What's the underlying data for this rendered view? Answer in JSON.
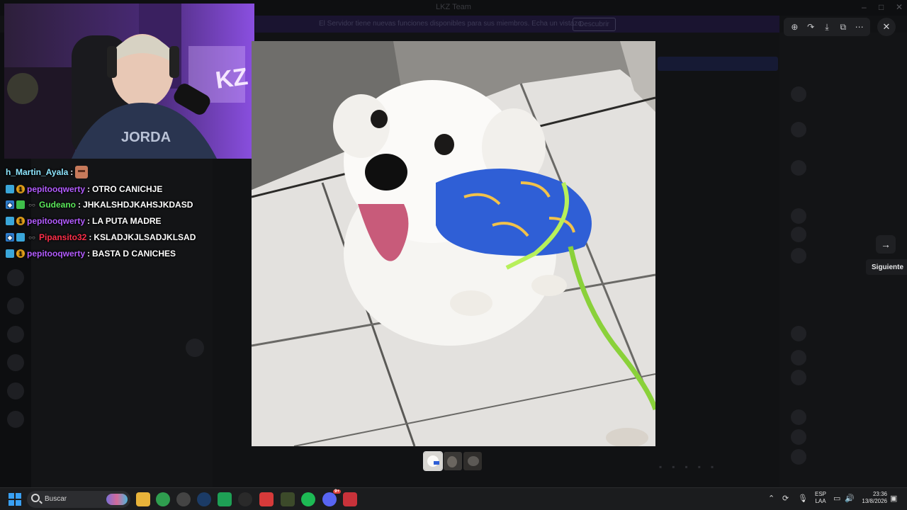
{
  "window": {
    "title": "LKZ Team",
    "banner_text": "El Servidor tiene nuevas funciones disponibles para sus miembros. Echa un vistazo.",
    "banner_button": "Descubrir"
  },
  "viewer": {
    "toolbar_icons": [
      "zoom-in-icon",
      "forward-icon",
      "download-icon",
      "open-external-icon",
      "more-icon"
    ],
    "close_icon": "close-icon",
    "next_icon": "arrow-right-icon",
    "next_tooltip": "Siguiente",
    "thumbnail_count": 3,
    "active_thumbnail": 1
  },
  "stream_chat": {
    "messages": [
      {
        "user": "h_Martin_Ayala",
        "msg": "",
        "emote": true,
        "color": "#8ee6ff"
      },
      {
        "user": "pepitooqwerty",
        "msg": "OTRO CANICHJE",
        "color": "#b35cff"
      },
      {
        "user": "Gudeano",
        "msg": "JHKALSHDJKAHSJKDASD",
        "color": "#5be85b"
      },
      {
        "user": "pepitooqwerty",
        "msg": "LA PUTA MADRE",
        "color": "#b35cff"
      },
      {
        "user": "Pipansito32",
        "msg": "KSLADJKJLSADJKLSAD",
        "color": "#ff2f4a"
      },
      {
        "user": "pepitooqwerty",
        "msg": "BASTA D CANICHES",
        "color": "#b35cff"
      }
    ],
    "separator": " : "
  },
  "taskbar": {
    "search_placeholder": "Buscar",
    "discord_badge": "9+",
    "language_line1": "ESP",
    "language_line2": "LAA",
    "time": "23:36",
    "date": "13/8/2026"
  },
  "colors": {
    "accent": "#5865f2",
    "viewer_button_bg": "#1f2023"
  }
}
